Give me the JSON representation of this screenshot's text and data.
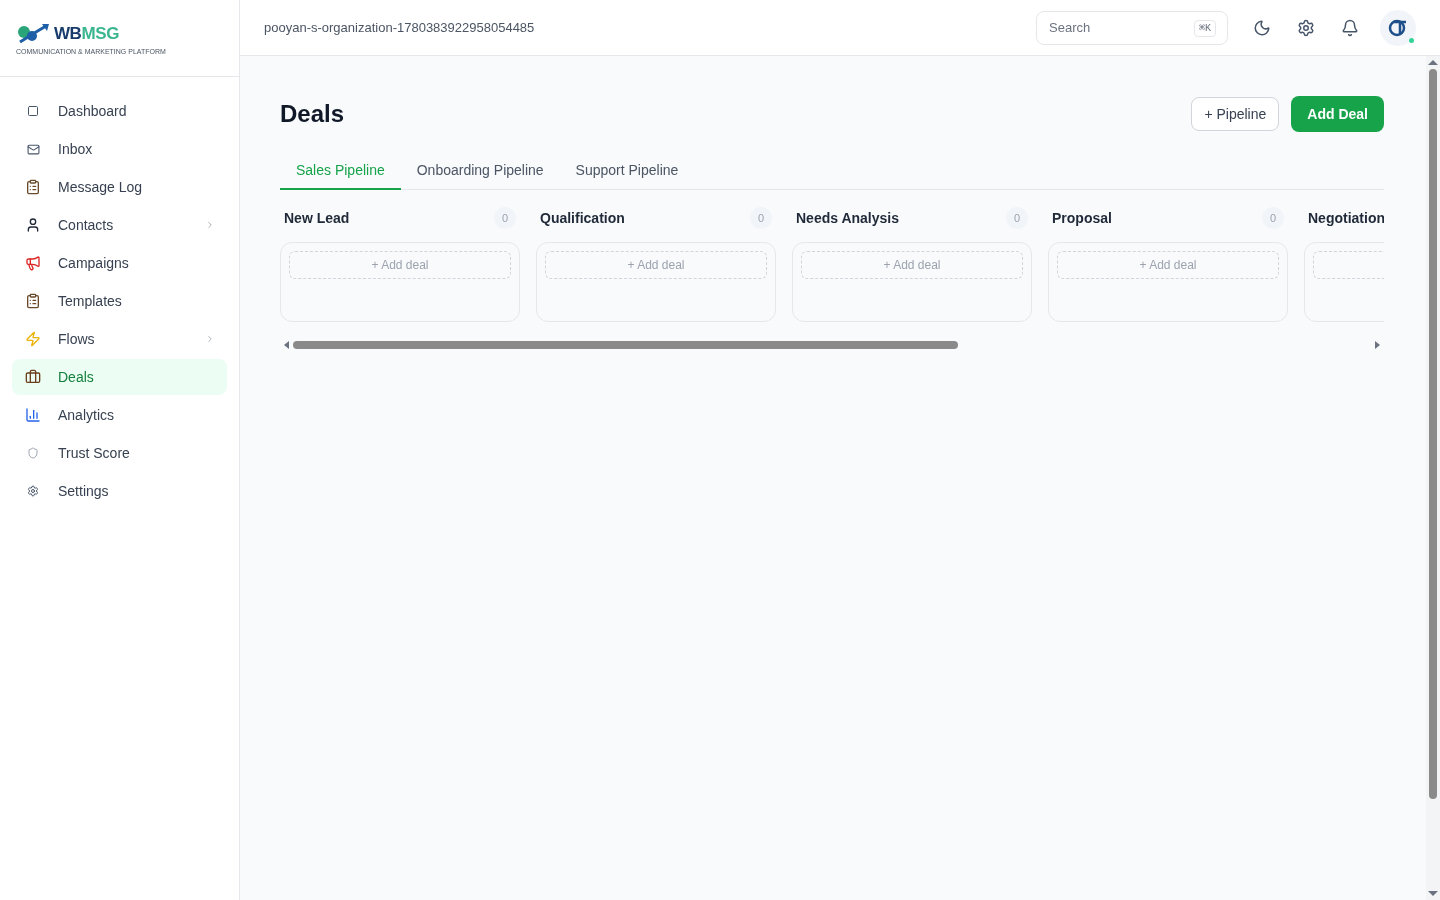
{
  "logo": {
    "name_dark": "WB",
    "name_accent": "MSG",
    "tagline": "COMMUNICATION & MARKETING PLATFORM"
  },
  "sidebar": {
    "items": [
      {
        "label": "Dashboard",
        "selected": false,
        "has_children": false
      },
      {
        "label": "Inbox",
        "selected": false,
        "has_children": false
      },
      {
        "label": "Message Log",
        "selected": false,
        "has_children": false
      },
      {
        "label": "Contacts",
        "selected": false,
        "has_children": true
      },
      {
        "label": "Campaigns",
        "selected": false,
        "has_children": false
      },
      {
        "label": "Templates",
        "selected": false,
        "has_children": false
      },
      {
        "label": "Flows",
        "selected": false,
        "has_children": true
      },
      {
        "label": "Deals",
        "selected": true,
        "has_children": false
      },
      {
        "label": "Analytics",
        "selected": false,
        "has_children": false
      },
      {
        "label": "Trust Score",
        "selected": false,
        "has_children": false
      },
      {
        "label": "Settings",
        "selected": false,
        "has_children": false
      }
    ]
  },
  "header": {
    "organization": "pooyan-s-organization-1780383922958054485",
    "search": {
      "placeholder": "Search",
      "shortcut": "⌘K"
    }
  },
  "page": {
    "title": "Deals",
    "buttons": [
      {
        "label": "+ Pipeline",
        "kind": "outline"
      },
      {
        "label": "Add Deal",
        "kind": "primary"
      }
    ]
  },
  "tabs": [
    {
      "label": "Sales Pipeline",
      "selected": true
    },
    {
      "label": "Onboarding Pipeline",
      "selected": false
    },
    {
      "label": "Support Pipeline",
      "selected": false
    }
  ],
  "stages": [
    {
      "name": "New Lead",
      "count": "0",
      "add_label": "+ Add deal"
    },
    {
      "name": "Qualification",
      "count": "0",
      "add_label": "+ Add deal"
    },
    {
      "name": "Needs Analysis",
      "count": "0",
      "add_label": "+ Add deal"
    },
    {
      "name": "Proposal",
      "count": "0",
      "add_label": "+ Add deal"
    },
    {
      "name": "Negotiation"
    }
  ]
}
